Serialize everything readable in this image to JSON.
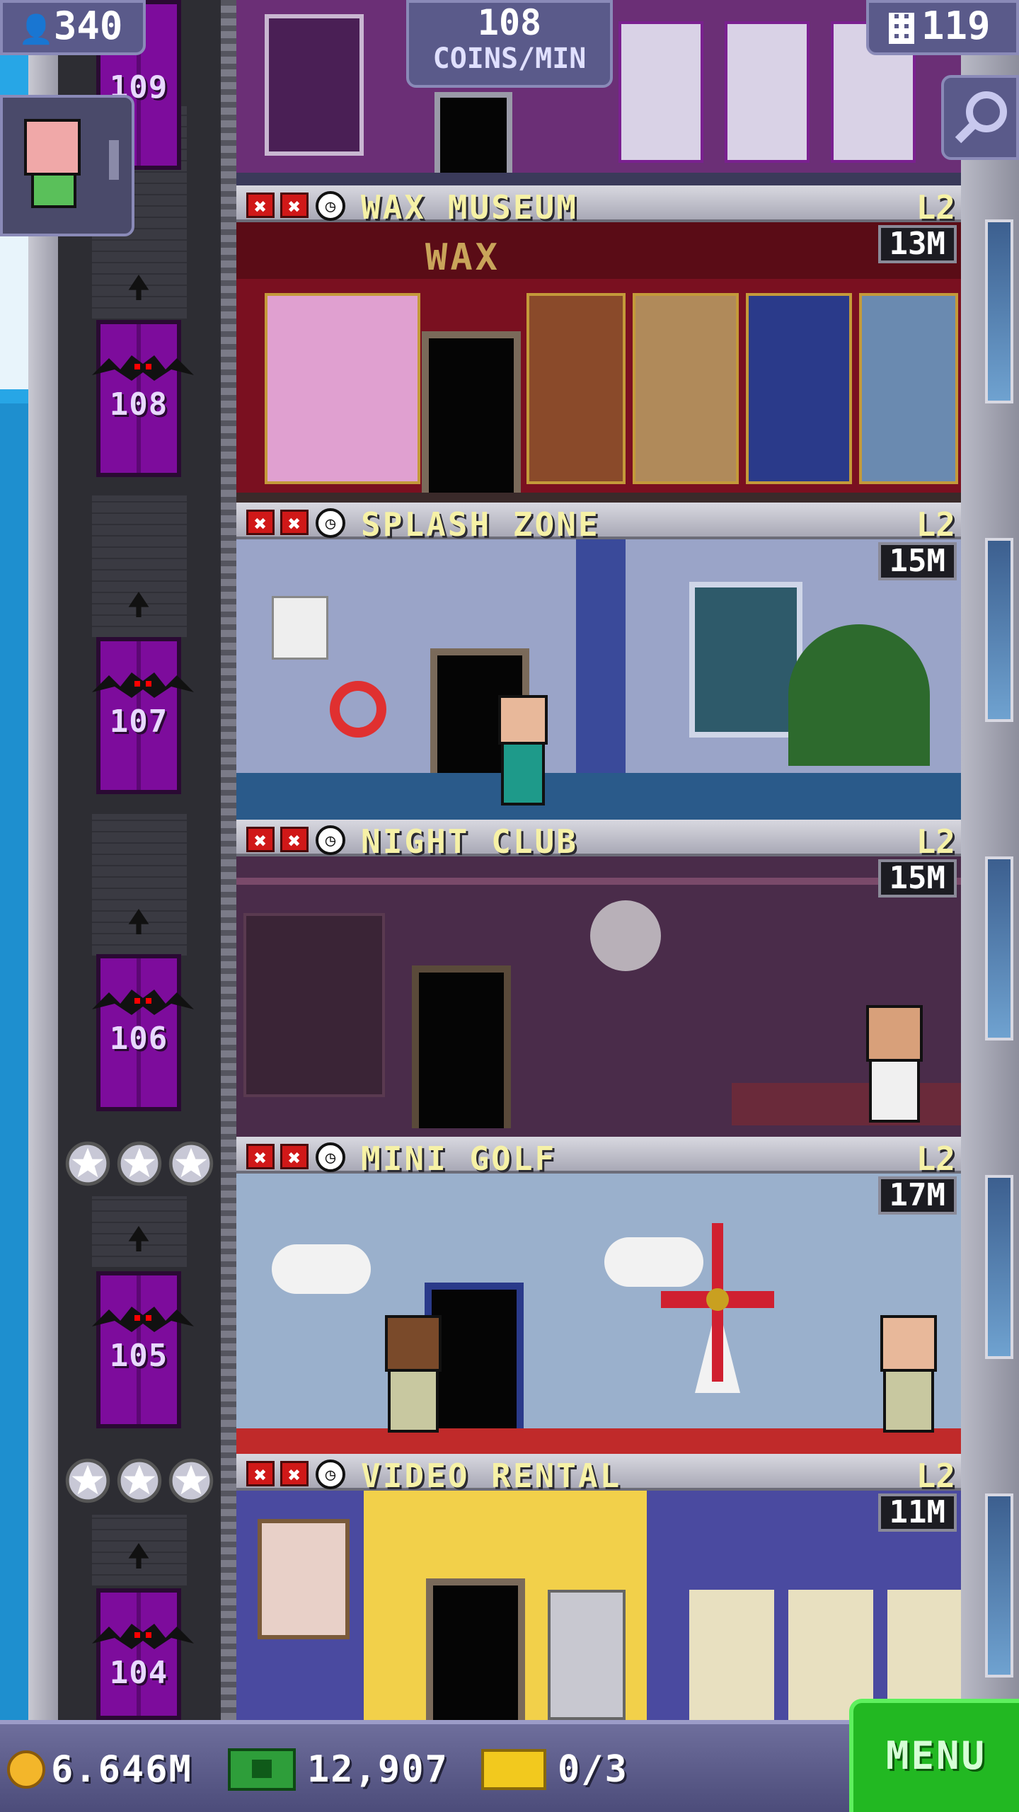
{
  "top": {
    "population": "340",
    "coins_rate_value": "108",
    "coins_rate_unit": "COINS/MIN",
    "floors_count": "119"
  },
  "elevator": {
    "floor_numbers": [
      "109",
      "108",
      "107",
      "106",
      "105",
      "104"
    ]
  },
  "floors": [
    {
      "name": "WAX MUSEUM",
      "level": "L2",
      "earnings": "13M",
      "sign": "WAX"
    },
    {
      "name": "SPLASH ZONE",
      "level": "L2",
      "earnings": "15M"
    },
    {
      "name": "NIGHT CLUB",
      "level": "L2",
      "earnings": "15M"
    },
    {
      "name": "MINI GOLF",
      "level": "L2",
      "earnings": "17M"
    },
    {
      "name": "VIDEO RENTAL",
      "level": "L2",
      "earnings": "11M"
    }
  ],
  "status_icons": {
    "cancel_symbol": "✖",
    "timer_symbol": "◷"
  },
  "bottom": {
    "coins": "6.646M",
    "bux": "12,907",
    "tickets": "0/3",
    "menu_label": "MENU"
  },
  "colors": {
    "elevator": "#7d0c9c",
    "header_text": "#f6f1a6",
    "menu_green": "#22b822",
    "cancel_red": "#d01818"
  },
  "icons": [
    "population-icon",
    "floors-grid-icon",
    "search-zoom-icon",
    "coin-icon",
    "bux-icon",
    "ticket-icon",
    "bat-icon",
    "star-icon",
    "clock-icon",
    "cancel-x-icon"
  ]
}
